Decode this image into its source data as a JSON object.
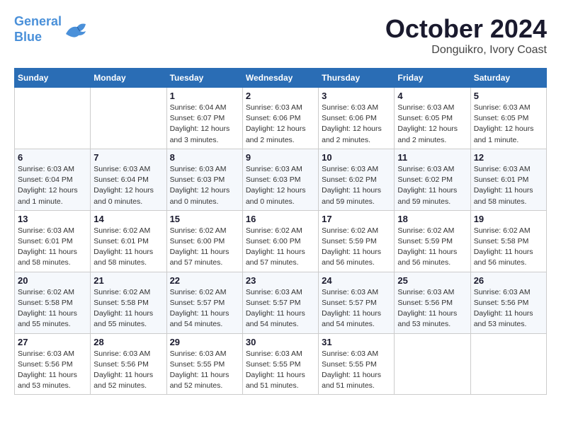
{
  "header": {
    "logo_line1": "General",
    "logo_line2": "Blue",
    "month_title": "October 2024",
    "subtitle": "Donguikro, Ivory Coast"
  },
  "weekdays": [
    "Sunday",
    "Monday",
    "Tuesday",
    "Wednesday",
    "Thursday",
    "Friday",
    "Saturday"
  ],
  "weeks": [
    [
      {
        "day": "",
        "info": ""
      },
      {
        "day": "",
        "info": ""
      },
      {
        "day": "1",
        "info": "Sunrise: 6:04 AM\nSunset: 6:07 PM\nDaylight: 12 hours and 3 minutes."
      },
      {
        "day": "2",
        "info": "Sunrise: 6:03 AM\nSunset: 6:06 PM\nDaylight: 12 hours and 2 minutes."
      },
      {
        "day": "3",
        "info": "Sunrise: 6:03 AM\nSunset: 6:06 PM\nDaylight: 12 hours and 2 minutes."
      },
      {
        "day": "4",
        "info": "Sunrise: 6:03 AM\nSunset: 6:05 PM\nDaylight: 12 hours and 2 minutes."
      },
      {
        "day": "5",
        "info": "Sunrise: 6:03 AM\nSunset: 6:05 PM\nDaylight: 12 hours and 1 minute."
      }
    ],
    [
      {
        "day": "6",
        "info": "Sunrise: 6:03 AM\nSunset: 6:04 PM\nDaylight: 12 hours and 1 minute."
      },
      {
        "day": "7",
        "info": "Sunrise: 6:03 AM\nSunset: 6:04 PM\nDaylight: 12 hours and 0 minutes."
      },
      {
        "day": "8",
        "info": "Sunrise: 6:03 AM\nSunset: 6:03 PM\nDaylight: 12 hours and 0 minutes."
      },
      {
        "day": "9",
        "info": "Sunrise: 6:03 AM\nSunset: 6:03 PM\nDaylight: 12 hours and 0 minutes."
      },
      {
        "day": "10",
        "info": "Sunrise: 6:03 AM\nSunset: 6:02 PM\nDaylight: 11 hours and 59 minutes."
      },
      {
        "day": "11",
        "info": "Sunrise: 6:03 AM\nSunset: 6:02 PM\nDaylight: 11 hours and 59 minutes."
      },
      {
        "day": "12",
        "info": "Sunrise: 6:03 AM\nSunset: 6:01 PM\nDaylight: 11 hours and 58 minutes."
      }
    ],
    [
      {
        "day": "13",
        "info": "Sunrise: 6:03 AM\nSunset: 6:01 PM\nDaylight: 11 hours and 58 minutes."
      },
      {
        "day": "14",
        "info": "Sunrise: 6:02 AM\nSunset: 6:01 PM\nDaylight: 11 hours and 58 minutes."
      },
      {
        "day": "15",
        "info": "Sunrise: 6:02 AM\nSunset: 6:00 PM\nDaylight: 11 hours and 57 minutes."
      },
      {
        "day": "16",
        "info": "Sunrise: 6:02 AM\nSunset: 6:00 PM\nDaylight: 11 hours and 57 minutes."
      },
      {
        "day": "17",
        "info": "Sunrise: 6:02 AM\nSunset: 5:59 PM\nDaylight: 11 hours and 56 minutes."
      },
      {
        "day": "18",
        "info": "Sunrise: 6:02 AM\nSunset: 5:59 PM\nDaylight: 11 hours and 56 minutes."
      },
      {
        "day": "19",
        "info": "Sunrise: 6:02 AM\nSunset: 5:58 PM\nDaylight: 11 hours and 56 minutes."
      }
    ],
    [
      {
        "day": "20",
        "info": "Sunrise: 6:02 AM\nSunset: 5:58 PM\nDaylight: 11 hours and 55 minutes."
      },
      {
        "day": "21",
        "info": "Sunrise: 6:02 AM\nSunset: 5:58 PM\nDaylight: 11 hours and 55 minutes."
      },
      {
        "day": "22",
        "info": "Sunrise: 6:02 AM\nSunset: 5:57 PM\nDaylight: 11 hours and 54 minutes."
      },
      {
        "day": "23",
        "info": "Sunrise: 6:03 AM\nSunset: 5:57 PM\nDaylight: 11 hours and 54 minutes."
      },
      {
        "day": "24",
        "info": "Sunrise: 6:03 AM\nSunset: 5:57 PM\nDaylight: 11 hours and 54 minutes."
      },
      {
        "day": "25",
        "info": "Sunrise: 6:03 AM\nSunset: 5:56 PM\nDaylight: 11 hours and 53 minutes."
      },
      {
        "day": "26",
        "info": "Sunrise: 6:03 AM\nSunset: 5:56 PM\nDaylight: 11 hours and 53 minutes."
      }
    ],
    [
      {
        "day": "27",
        "info": "Sunrise: 6:03 AM\nSunset: 5:56 PM\nDaylight: 11 hours and 53 minutes."
      },
      {
        "day": "28",
        "info": "Sunrise: 6:03 AM\nSunset: 5:56 PM\nDaylight: 11 hours and 52 minutes."
      },
      {
        "day": "29",
        "info": "Sunrise: 6:03 AM\nSunset: 5:55 PM\nDaylight: 11 hours and 52 minutes."
      },
      {
        "day": "30",
        "info": "Sunrise: 6:03 AM\nSunset: 5:55 PM\nDaylight: 11 hours and 51 minutes."
      },
      {
        "day": "31",
        "info": "Sunrise: 6:03 AM\nSunset: 5:55 PM\nDaylight: 11 hours and 51 minutes."
      },
      {
        "day": "",
        "info": ""
      },
      {
        "day": "",
        "info": ""
      }
    ]
  ]
}
